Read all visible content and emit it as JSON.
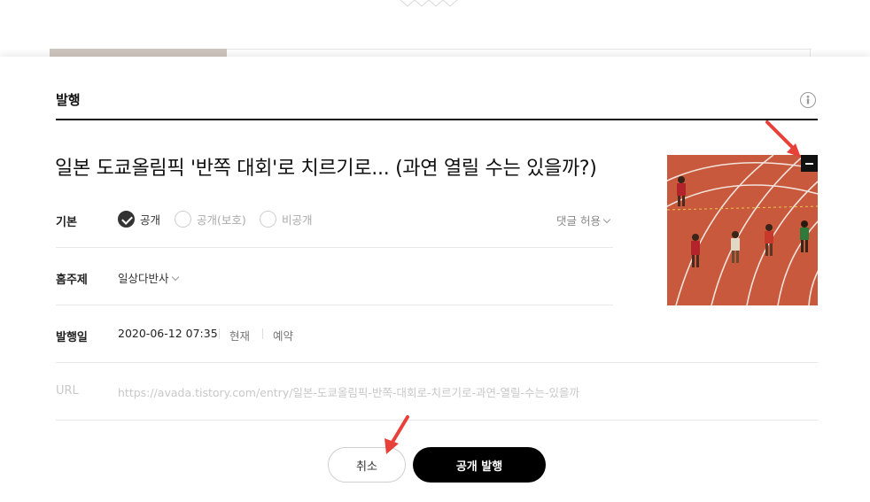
{
  "dialog": {
    "title": "발행",
    "post_title": "일본 도쿄올림픽 '반쪽 대회'로 치르기로... (과연 열릴 수는 있을까?)"
  },
  "basic": {
    "label": "기본",
    "visibility_options": [
      {
        "label": "공개",
        "checked": true
      },
      {
        "label": "공개(보호)",
        "checked": false
      },
      {
        "label": "비공개",
        "checked": false
      }
    ],
    "comment_setting": "댓글 허용"
  },
  "topic": {
    "label": "홈주제",
    "selected": "일상다반사"
  },
  "publish_date": {
    "label": "발행일",
    "value": "2020-06-12 07:35",
    "now_label": "현재",
    "reserve_label": "예약"
  },
  "url": {
    "label": "URL",
    "value": "https://avada.tistory.com/entry/일본-도쿄올림픽-반쪽-대회로-치르기로-과연-열릴-수는-있을까"
  },
  "buttons": {
    "cancel": "취소",
    "publish": "공개 발행"
  },
  "icons": {
    "help": "help-icon",
    "remove_thumbnail": "minus-icon",
    "dropdown": "chevron-down-icon"
  },
  "colors": {
    "primary_button": "#000000",
    "annotation_arrow": "#e8413a",
    "track": "#c9593c"
  }
}
